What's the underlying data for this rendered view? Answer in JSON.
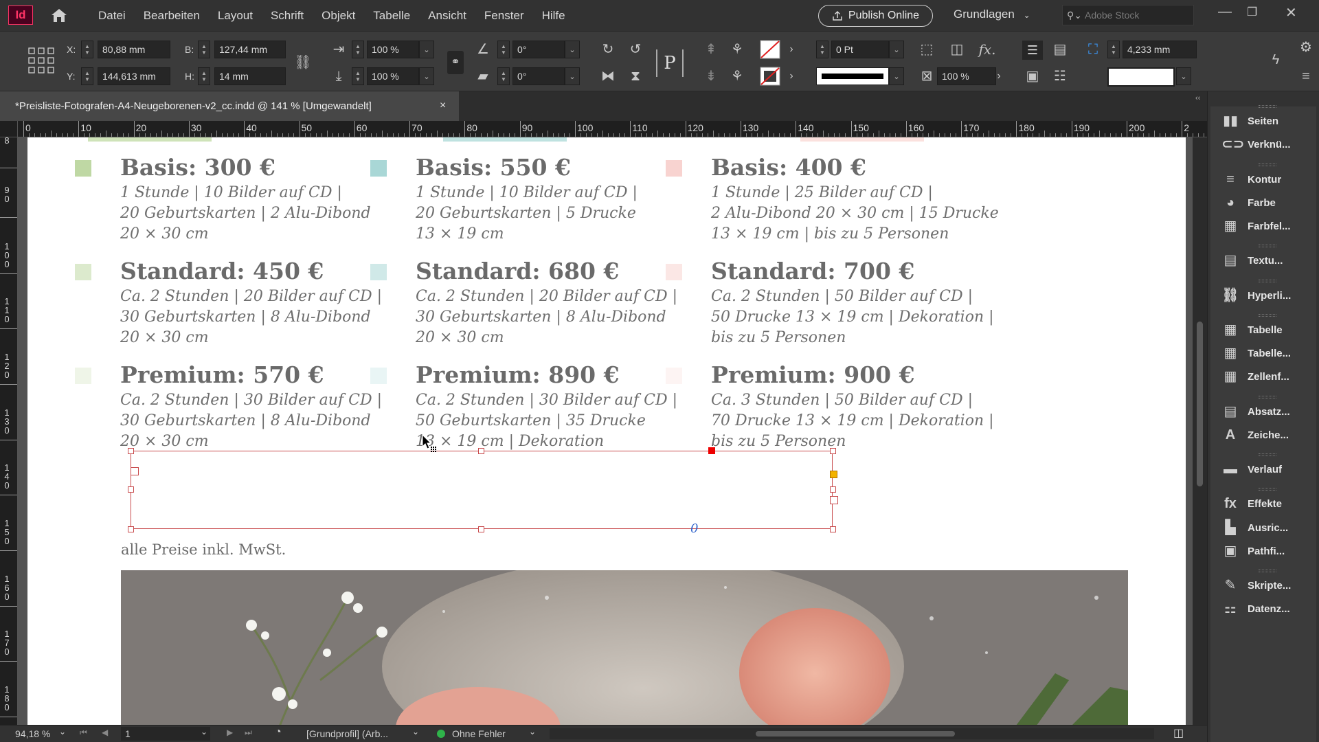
{
  "app": {
    "logo": "Id"
  },
  "menu": [
    "Datei",
    "Bearbeiten",
    "Layout",
    "Schrift",
    "Objekt",
    "Tabelle",
    "Ansicht",
    "Fenster",
    "Hilfe"
  ],
  "publish_label": "Publish Online",
  "workspace_label": "Grundlagen",
  "stock_placeholder": "Adobe Stock",
  "window_controls": [
    "—",
    "❐",
    "✕"
  ],
  "control": {
    "x_label": "X:",
    "x_value": "80,88 mm",
    "y_label": "Y:",
    "y_value": "144,613 mm",
    "w_label": "B:",
    "w_value": "127,44 mm",
    "h_label": "H:",
    "h_value": "14 mm",
    "scale_x": "100 %",
    "scale_y": "100 %",
    "rotation": "0°",
    "shear": "0°",
    "stroke_weight": "0 Pt",
    "opacity": "100 %",
    "measure": "4,233 mm"
  },
  "doc_tab": {
    "title": "*Preisliste-Fotografen-A4-Neugeborenen-v2_cc.indd @ 141 % [Umgewandelt]",
    "close": "×"
  },
  "ruler_h": [
    "0",
    "10",
    "20",
    "30",
    "40",
    "50",
    "60",
    "70",
    "80",
    "90",
    "100",
    "110",
    "120",
    "130",
    "140",
    "150",
    "160",
    "170",
    "180",
    "190",
    "200",
    "2"
  ],
  "ruler_v": [
    "8",
    "90",
    "100",
    "110",
    "120",
    "130",
    "140",
    "150",
    "160",
    "170",
    "180"
  ],
  "packages": [
    {
      "color": "#bfd8a4",
      "items": [
        {
          "title": "Basis: 300 €",
          "lines": [
            "1 Stunde | 10 Bilder auf CD |",
            "20 Geburtskarten | 2 Alu-Dibond",
            "20 × 30 cm"
          ]
        },
        {
          "title": "Standard: 450 €",
          "lines": [
            "Ca. 2 Stunden | 20 Bilder auf CD |",
            "30 Geburtskarten | 8 Alu-Dibond",
            "20 × 30 cm"
          ]
        },
        {
          "title": "Premium: 570 €",
          "lines": [
            "Ca. 2 Stunden | 30 Bilder auf CD |",
            "30 Geburtskarten | 8 Alu-Dibond",
            "20 × 30 cm"
          ]
        }
      ]
    },
    {
      "color": "#a9d7d6",
      "items": [
        {
          "title": "Basis: 550 €",
          "lines": [
            "1 Stunde | 10 Bilder auf CD |",
            "20 Geburtskarten | 5 Drucke",
            "13 × 19 cm"
          ]
        },
        {
          "title": "Standard: 680 €",
          "lines": [
            "Ca. 2 Stunden | 20 Bilder auf CD |",
            "30 Geburtskarten | 8 Alu-Dibond",
            "20 × 30 cm"
          ]
        },
        {
          "title": "Premium: 890 €",
          "lines": [
            "Ca. 2 Stunden | 30 Bilder auf CD |",
            "50 Geburtskarten | 35 Drucke",
            "13 × 19 cm | Dekoration"
          ]
        }
      ]
    },
    {
      "color": "#f8d3d0",
      "items": [
        {
          "title": "Basis: 400 €",
          "lines": [
            "1 Stunde | 25 Bilder auf CD |",
            "2 Alu-Dibond 20 × 30 cm | 15 Drucke",
            "13 × 19 cm | bis zu 5 Personen"
          ]
        },
        {
          "title": "Standard: 700 €",
          "lines": [
            "Ca. 2 Stunden | 50 Bilder auf CD |",
            "50 Drucke 13 × 19 cm | Dekoration |",
            "bis zu 5 Personen"
          ]
        },
        {
          "title": "Premium: 900 €",
          "lines": [
            "Ca. 3 Stunden | 50 Bilder auf CD |",
            "70 Drucke 13 × 19 cm | Dekoration |",
            "bis zu 5 Personen"
          ]
        }
      ]
    }
  ],
  "footnote": "alle Preise inkl. MwSt.",
  "status": {
    "zoom": "94,18 %",
    "page": "1",
    "profile": "[Grundprofil] (Arb...",
    "errors": "Ohne Fehler"
  },
  "panels": [
    "Seiten",
    "Verknü...",
    "Kontur",
    "Farbe",
    "Farbfel...",
    "Textu...",
    "Hyperli...",
    "Tabelle",
    "Tabelle...",
    "Zellenf...",
    "Absatz...",
    "Zeiche...",
    "Verlauf",
    "Effekte",
    "Ausric...",
    "Pathfi...",
    "Skripte...",
    "Datenz..."
  ],
  "panel_icons": [
    "pages-icon",
    "links-icon",
    "stroke-icon",
    "color-icon",
    "swatches-icon",
    "text-wrap-icon",
    "hyperlinks-icon",
    "table-icon",
    "table-styles-icon",
    "cell-styles-icon",
    "paragraph-styles-icon",
    "character-styles-icon",
    "gradient-icon",
    "effects-icon",
    "align-icon",
    "pathfinder-icon",
    "scripts-icon",
    "data-merge-icon"
  ]
}
